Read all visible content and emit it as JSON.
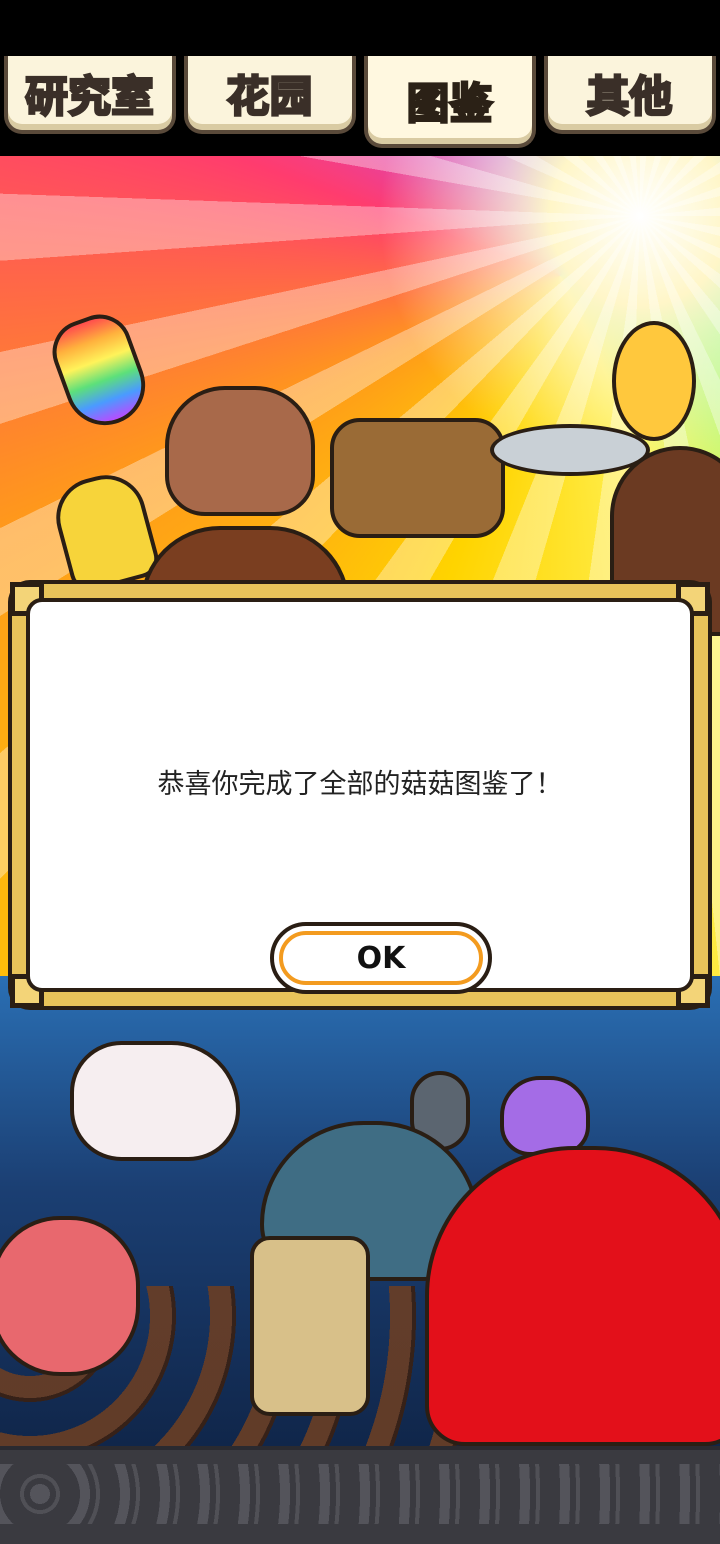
{
  "tabs": [
    {
      "label": "研究室",
      "active": false
    },
    {
      "label": "花园",
      "active": false
    },
    {
      "label": "图鉴",
      "active": true
    },
    {
      "label": "其他",
      "active": false
    }
  ],
  "dialog": {
    "message": "恭喜你完成了全部的菇菇图鉴了！",
    "ok_label": "OK"
  },
  "colors": {
    "tab_active_text": "#ffe21a",
    "dialog_gold": "#e8c35a",
    "ok_ring": "#f39b1f"
  }
}
